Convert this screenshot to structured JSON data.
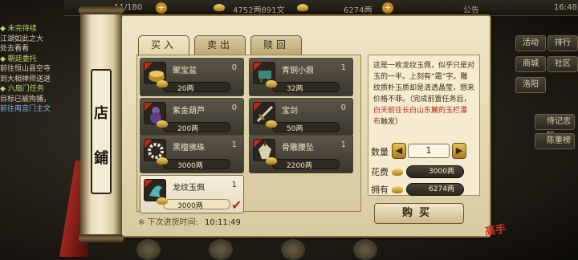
{
  "topbar": {
    "energy": "11/180",
    "currency": "4752两891文",
    "gold": "6274两",
    "announce": "公告",
    "time": "16:48"
  },
  "quests": [
    {
      "text": "◆ 未完待续",
      "kind": "title"
    },
    {
      "text": "江湖如此之大",
      "kind": "body"
    },
    {
      "text": "处去看看",
      "kind": "body"
    },
    {
      "text": "◆ 朝廷委托",
      "kind": "title"
    },
    {
      "text": "前往恒山县空寺",
      "kind": "body"
    },
    {
      "text": "到大相禅师送进",
      "kind": "body"
    },
    {
      "text": "◆ 六扇门任务",
      "kind": "title"
    },
    {
      "text": "目标已被拘捕，",
      "kind": "body"
    },
    {
      "text": "前往南宫门主文",
      "kind": "hl"
    }
  ],
  "right_menu": {
    "activity": "活动",
    "rank": "排行",
    "mall": "商城",
    "community": "社区",
    "luoyang": "洛阳",
    "map_corner": "",
    "diary": "侍记志玩",
    "ranking_board": "陈董榜"
  },
  "shop": {
    "sign": [
      "店",
      "鋪"
    ],
    "tabs": [
      "买入",
      "卖出",
      "赎回"
    ],
    "active_tab": 0,
    "items": [
      {
        "name": "聚宝盆",
        "qty": "0",
        "price": "20两",
        "selected": false
      },
      {
        "name": "青铜小鼎",
        "qty": "1",
        "price": "32两",
        "selected": false
      },
      {
        "name": "紫金葫芦",
        "qty": "0",
        "price": "200两",
        "selected": false
      },
      {
        "name": "宝剑",
        "qty": "0",
        "price": "50两",
        "selected": false
      },
      {
        "name": "黑檀佛珠",
        "qty": "1",
        "price": "3000两",
        "selected": false
      },
      {
        "name": "骨雕腰坠",
        "qty": "1",
        "price": "2200两",
        "selected": false
      },
      {
        "name": "龙纹玉佩",
        "qty": "1",
        "price": "3000两",
        "selected": true
      }
    ],
    "restock_label": "※ 下次进货时间:",
    "restock_time": "10:11:49",
    "description": {
      "part1": "这是一枚龙纹玉佩，似乎只是对玉的一半。上刻有“霜”字。雕纹质朴玉质却是清透晶莹，想来价格不菲。（完成前置任务后，",
      "part2": "白天前往长白山东麓的",
      "part3": "玉栏瀑布",
      "part4": "触发）"
    },
    "quantity_label": "数量",
    "quantity": "1",
    "cost_label": "花费",
    "cost": "3000两",
    "owned_label": "拥有",
    "owned": "6274两",
    "buy_label": "购买",
    "stamp": "高手"
  },
  "colors": {
    "accent_red": "#c62a1d",
    "gold": "#e8c154",
    "parchment": "#efe5c7"
  }
}
